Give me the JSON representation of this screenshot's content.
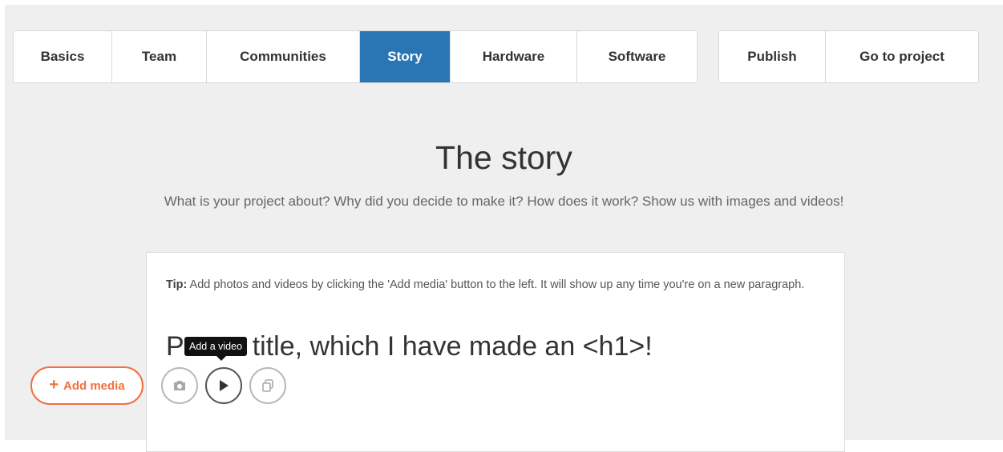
{
  "nav": {
    "tabs": [
      {
        "label": "Basics",
        "active": false
      },
      {
        "label": "Team",
        "active": false
      },
      {
        "label": "Communities",
        "active": false
      },
      {
        "label": "Story",
        "active": true
      },
      {
        "label": "Hardware",
        "active": false
      },
      {
        "label": "Software",
        "active": false
      }
    ],
    "actions": [
      {
        "label": "Publish"
      },
      {
        "label": "Go to project"
      }
    ]
  },
  "story": {
    "title": "The story",
    "subtitle": "What is your project about? Why did you decide to make it? How does it work? Show us with images and videos!"
  },
  "editor": {
    "tip_label": "Tip:",
    "tip_text": " Add photos and videos by clicking the 'Add media' button to the left. It will show up any time you're on a new paragraph.",
    "heading_text_start": "P",
    "heading_text_end": "title, which I have made an <h1>!",
    "tooltip": "Add a video"
  },
  "media": {
    "add_label": "Add media",
    "add_icon": "plus-icon",
    "buttons": [
      "camera-icon",
      "play-icon",
      "embed-icon"
    ]
  },
  "colors": {
    "accent": "#2a75b3",
    "add_media": "#f0703f",
    "background": "#efefef"
  }
}
